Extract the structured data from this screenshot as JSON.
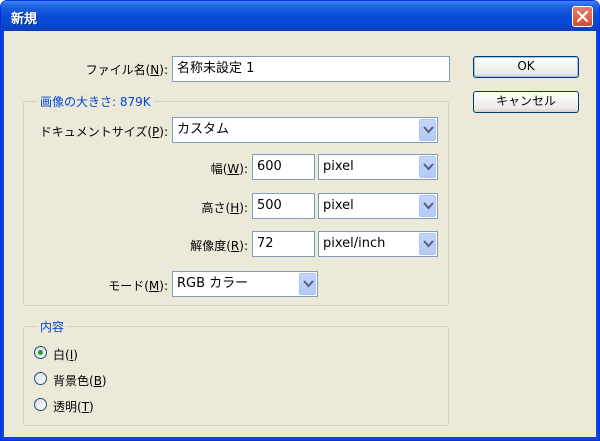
{
  "window": {
    "title": "新規"
  },
  "form": {
    "filename": {
      "label": "ファイル名(",
      "mnemonic": "N",
      "label_end": "):",
      "value": "名称未設定 1"
    },
    "image_size": {
      "title": "画像の大きさ: 879K"
    },
    "document_size": {
      "label": "ドキュメントサイズ(",
      "mnemonic": "P",
      "label_end": "):",
      "value": "カスタム"
    },
    "width": {
      "label": "幅(",
      "mnemonic": "W",
      "label_end": "):",
      "value": "600",
      "unit": "pixel"
    },
    "height": {
      "label": "高さ(",
      "mnemonic": "H",
      "label_end": "):",
      "value": "500",
      "unit": "pixel"
    },
    "resolution": {
      "label": "解像度(",
      "mnemonic": "R",
      "label_end": "):",
      "value": "72",
      "unit": "pixel/inch"
    },
    "mode": {
      "label": "モード(",
      "mnemonic": "M",
      "label_end": "):",
      "value": "RGB カラー"
    }
  },
  "contents": {
    "title": "内容",
    "options": [
      {
        "label": "白(",
        "mnemonic": "I",
        "label_end": ")",
        "selected": true
      },
      {
        "label": "背景色(",
        "mnemonic": "B",
        "label_end": ")",
        "selected": false
      },
      {
        "label": "透明(",
        "mnemonic": "T",
        "label_end": ")",
        "selected": false
      }
    ]
  },
  "buttons": {
    "ok": "OK",
    "cancel": "キャンセル"
  },
  "colors": {
    "title_bar": "#0a4bd6",
    "group_title": "#0046d5",
    "dialog_bg": "#ece9d8",
    "close_button": "#d34c2c"
  },
  "icons": {
    "close": "close-icon",
    "dropdown": "chevron-down-icon",
    "radio_selected": "radio-selected-icon"
  }
}
